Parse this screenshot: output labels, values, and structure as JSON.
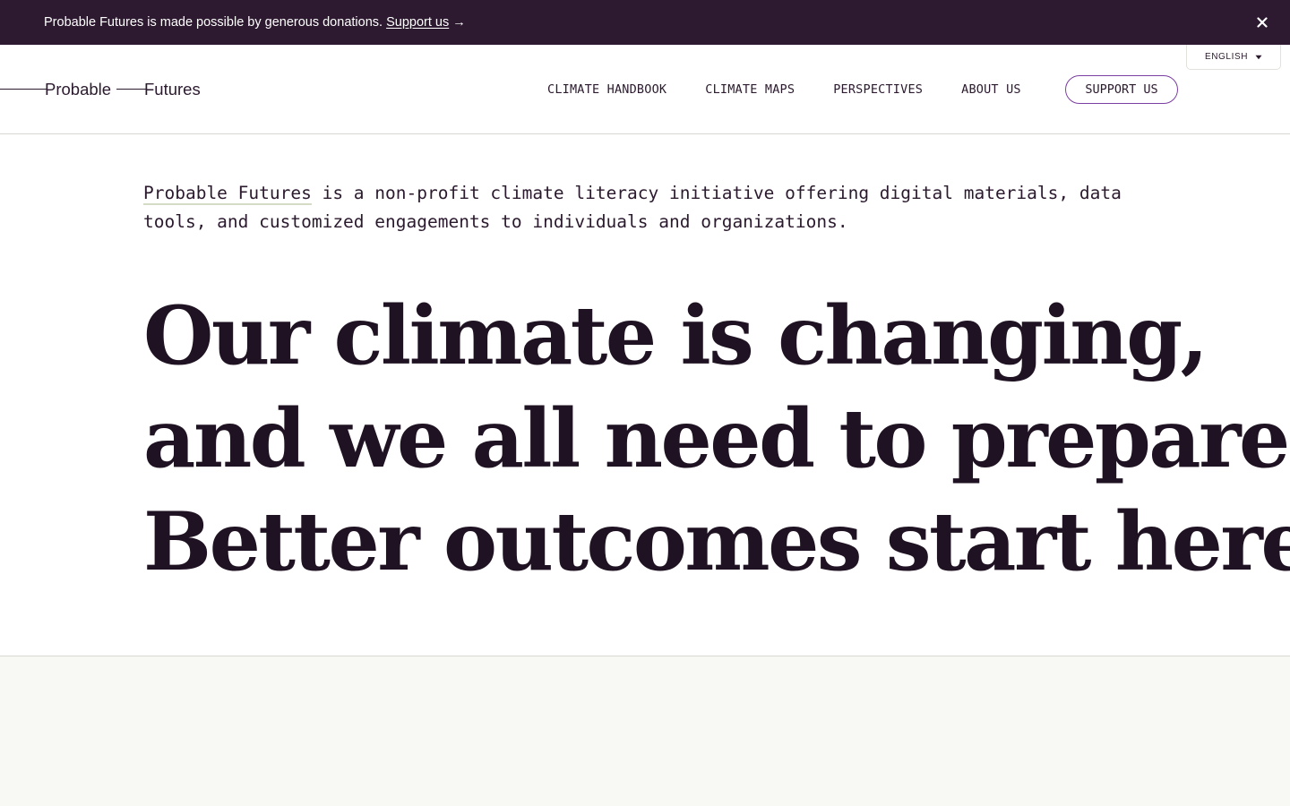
{
  "banner": {
    "message": "Probable Futures is made possible by generous donations.",
    "link_label": "Support us",
    "arrow": "→",
    "close_icon": "close-icon"
  },
  "header": {
    "logo": {
      "word1": "Probable",
      "word2": "Futures"
    },
    "nav": [
      {
        "label": "CLIMATE HANDBOOK"
      },
      {
        "label": "CLIMATE MAPS"
      },
      {
        "label": "PERSPECTIVES"
      },
      {
        "label": "ABOUT US"
      }
    ],
    "support_label": "SUPPORT US",
    "language": {
      "selected": "ENGLISH",
      "icon": "caret-down-icon"
    }
  },
  "intro": {
    "link_text": "Probable Futures",
    "text": " is a non-profit climate literacy initiative offering digital materials, data tools, and customized engagements to individuals and organizations."
  },
  "hero": {
    "lines": [
      "Our climate is changing,",
      "and we all need to prepare.",
      "Better outcomes start here."
    ]
  },
  "colors": {
    "banner_bg": "#2d1a30",
    "text": "#2b1a2e",
    "accent_border": "#7b3fa3",
    "link_underline": "#d4dcc6",
    "panel_bg": "#f8f8f4"
  }
}
